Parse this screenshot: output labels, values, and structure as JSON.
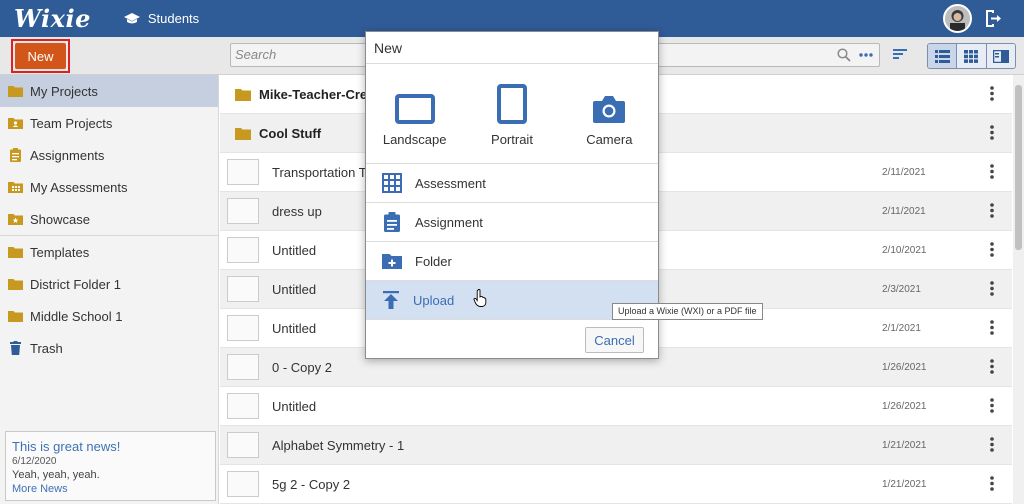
{
  "app": {
    "logo": "Wixie"
  },
  "header": {
    "students_label": "Students"
  },
  "toolbar": {
    "new_label": "New",
    "search_placeholder": "Search"
  },
  "sidebar": {
    "items": [
      {
        "label": "My Projects",
        "icon": "folder-icon"
      },
      {
        "label": "Team Projects",
        "icon": "team-folder-icon"
      },
      {
        "label": "Assignments",
        "icon": "clipboard-icon"
      },
      {
        "label": "My Assessments",
        "icon": "grid-folder-icon"
      },
      {
        "label": "Showcase",
        "icon": "star-folder-icon"
      },
      {
        "label": "Templates",
        "icon": "folder-icon"
      },
      {
        "label": "District Folder 1",
        "icon": "folder-icon"
      },
      {
        "label": "Middle School 1",
        "icon": "folder-icon"
      },
      {
        "label": "Trash",
        "icon": "trash-icon"
      }
    ]
  },
  "news": {
    "title": "This is great news!",
    "date": "6/12/2020",
    "body": "Yeah, yeah, yeah.",
    "link": "More News"
  },
  "list": {
    "folders": [
      {
        "name": "Mike-Teacher-Create"
      },
      {
        "name": "Cool Stuff"
      }
    ],
    "files": [
      {
        "name": "Transportation Tir",
        "date": "2/11/2021"
      },
      {
        "name": "dress up",
        "date": "2/11/2021"
      },
      {
        "name": "Untitled",
        "date": "2/10/2021"
      },
      {
        "name": "Untitled",
        "date": "2/3/2021"
      },
      {
        "name": "Untitled",
        "date": "2/1/2021"
      },
      {
        "name": "0 - Copy 2",
        "date": "1/26/2021"
      },
      {
        "name": "Untitled",
        "date": "1/26/2021"
      },
      {
        "name": "Alphabet Symmetry - 1",
        "date": "1/21/2021"
      },
      {
        "name": "5g 2 - Copy 2",
        "date": "1/21/2021"
      }
    ]
  },
  "modal": {
    "title": "New",
    "tiles": [
      {
        "label": "Landscape"
      },
      {
        "label": "Portrait"
      },
      {
        "label": "Camera"
      }
    ],
    "items": [
      {
        "label": "Assessment"
      },
      {
        "label": "Assignment"
      },
      {
        "label": "Folder"
      },
      {
        "label": "Upload"
      }
    ],
    "cancel_label": "Cancel"
  },
  "tooltip": {
    "text": "Upload a Wixie (WXI) or a PDF file"
  },
  "colors": {
    "header": "#2f5b97",
    "new_button": "#d2561a",
    "accent": "#3a6db3",
    "folder": "#c79a1f"
  }
}
